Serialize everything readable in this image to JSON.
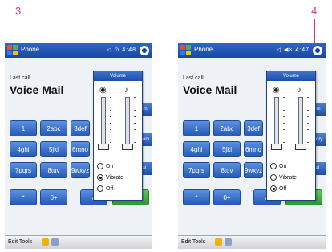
{
  "screens": [
    {
      "step": "3",
      "app_title": "Phone",
      "status_icons": "◁ ⊙ 4:48",
      "caller_sub": "Last call",
      "caller_name": "Voice Mail",
      "volume_title": "Volume",
      "ringer_options": [
        "On",
        "Vibrate",
        "Off"
      ],
      "selected_option": "Vibrate",
      "menu": "Edit  Tools",
      "keys": [
        "1",
        "2abc",
        "3def",
        "4ghi",
        "5jkl",
        "6mno",
        "7pqrs",
        "8tuv",
        "9wxyz",
        "*",
        "0+",
        "#"
      ],
      "talk_label": "Talk",
      "side_labels": [
        "Mem",
        "History",
        "Dial"
      ]
    },
    {
      "step": "4",
      "app_title": "Phone",
      "status_icons": "◁ ◀× 4:47",
      "caller_sub": "Last call",
      "caller_name": "Voice Mail",
      "volume_title": "Volume",
      "ringer_options": [
        "On",
        "Vibrate",
        "Off"
      ],
      "selected_option": "Off",
      "menu": "Edit  Tools",
      "keys": [
        "1",
        "2abc",
        "3def",
        "4ghi",
        "5jkl",
        "6mno",
        "7pqrs",
        "8tuv",
        "9wxyz",
        "*",
        "0+",
        "#"
      ],
      "talk_label": "Talk",
      "side_labels": [
        "Mem",
        "History",
        "Dial"
      ]
    }
  ],
  "colors": {
    "step_number": "#d6338a",
    "titlebar": "#1a47a3",
    "key_blue": "#2459b8",
    "key_green": "#2e9a2a"
  }
}
